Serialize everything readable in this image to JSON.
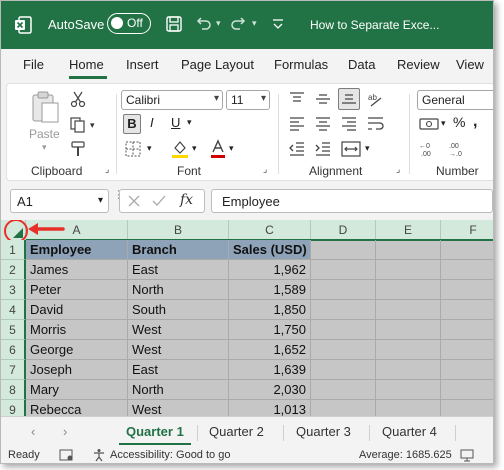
{
  "title_bar": {
    "autosave_label": "AutoSave",
    "autosave_state": "Off",
    "doc_title": "How to Separate Exce..."
  },
  "menu_tabs": [
    "File",
    "Home",
    "Insert",
    "Page Layout",
    "Formulas",
    "Data",
    "Review",
    "View"
  ],
  "ribbon": {
    "clipboard": {
      "paste_label": "Paste",
      "group_label": "Clipboard"
    },
    "font": {
      "font_name": "Calibri",
      "font_size": "11",
      "group_label": "Font"
    },
    "alignment": {
      "group_label": "Alignment"
    },
    "number": {
      "format": "General",
      "group_label": "Number"
    }
  },
  "formula_bar": {
    "name_box": "A1",
    "fx_label": "fx",
    "formula_value": "Employee"
  },
  "grid": {
    "columns": [
      "A",
      "B",
      "C",
      "D",
      "E",
      "F"
    ],
    "rows": [
      "1",
      "2",
      "3",
      "4",
      "5",
      "6",
      "7",
      "8",
      "9"
    ],
    "data": [
      [
        "Employee",
        "Branch",
        "Sales (USD)"
      ],
      [
        "James",
        "East",
        "1,962"
      ],
      [
        "Peter",
        "North",
        "1,589"
      ],
      [
        "David",
        "South",
        "1,850"
      ],
      [
        "Morris",
        "West",
        "1,750"
      ],
      [
        "George",
        "West",
        "1,652"
      ],
      [
        "Joseph",
        "East",
        "1,639"
      ],
      [
        "Mary",
        "North",
        "2,030"
      ],
      [
        "Rebecca",
        "West",
        "1,013"
      ]
    ]
  },
  "sheet_tabs": [
    "Quarter 1",
    "Quarter 2",
    "Quarter 3",
    "Quarter 4"
  ],
  "status_bar": {
    "ready": "Ready",
    "accessibility": "Accessibility: Good to go",
    "average": "Average: 1685.625"
  },
  "colors": {
    "excel_green": "#217346",
    "annotation_red": "#e8302a",
    "header_fill": "#8ea2b8",
    "selection_gray": "#c6c6c6"
  }
}
